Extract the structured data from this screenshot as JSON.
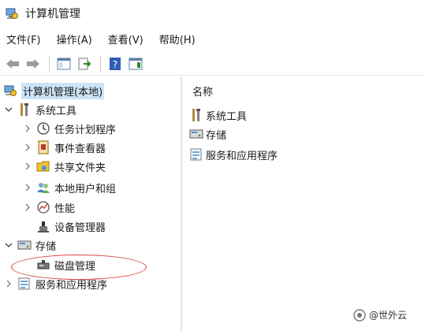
{
  "window": {
    "title": "计算机管理"
  },
  "menu": {
    "items": [
      "文件(F)",
      "操作(A)",
      "查看(V)",
      "帮助(H)"
    ]
  },
  "tree": {
    "root": "计算机管理(本地)",
    "system_tools": "系统工具",
    "task_scheduler": "任务计划程序",
    "event_viewer": "事件查看器",
    "shared_folders": "共享文件夹",
    "local_users_groups": "本地用户和组",
    "performance": "性能",
    "device_manager": "设备管理器",
    "storage": "存储",
    "disk_management": "磁盘管理",
    "services_apps": "服务和应用程序"
  },
  "list": {
    "column_name": "名称",
    "items": [
      "系统工具",
      "存储",
      "服务和应用程序"
    ]
  },
  "watermark": {
    "text": "@世外云"
  },
  "colors": {
    "selection": "#cce4f7",
    "annotation": "#d6443f"
  }
}
